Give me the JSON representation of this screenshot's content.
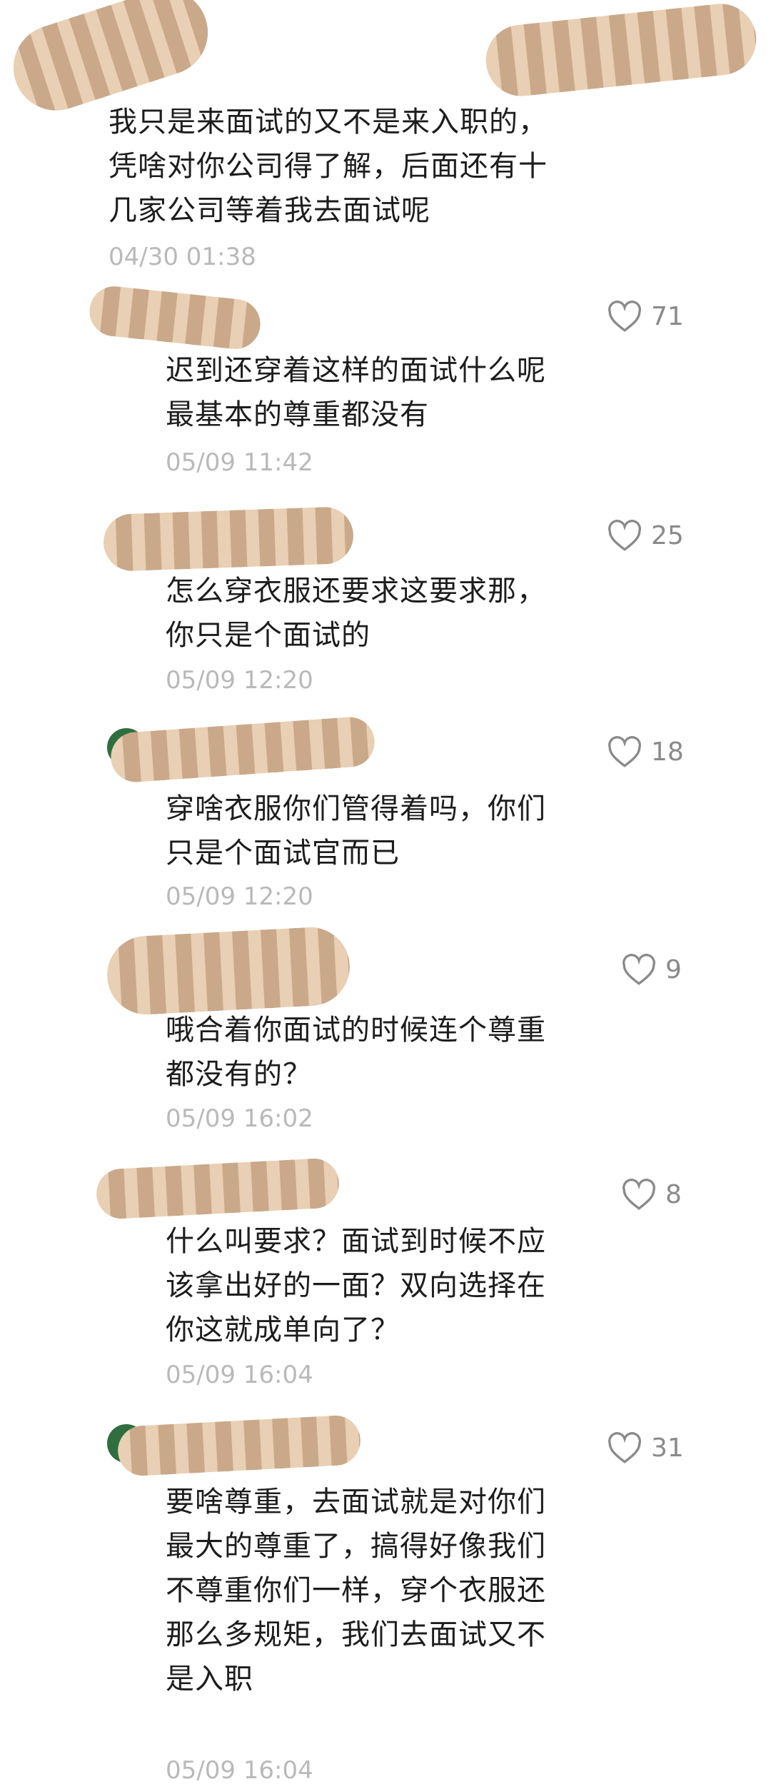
{
  "top_comment": {
    "text": "我只是来面试的又不是来入职的，\n凭啥对你公司得了解，后面还有十\n几家公司等着我去面试呢",
    "time": "04/30 01:38"
  },
  "replies": [
    {
      "text": "迟到还穿着这样的面试什么呢\n最基本的尊重都没有",
      "time": "05/09 11:42",
      "likes": "71"
    },
    {
      "text": "怎么穿衣服还要求这要求那，\n你只是个面试的",
      "time": "05/09 12:20",
      "likes": "25"
    },
    {
      "text": "穿啥衣服你们管得着吗，你们\n只是个面试官而已",
      "time": "05/09 12:20",
      "likes": "18"
    },
    {
      "text": "哦合着你面试的时候连个尊重\n都没有的？",
      "time": "05/09 16:02",
      "likes": "9"
    },
    {
      "text": "什么叫要求？面试到时候不应\n该拿出好的一面？双向选择在\n你这就成单向了？",
      "time": "05/09 16:04",
      "likes": "8"
    },
    {
      "text": "要啥尊重，去面试就是对你们\n最大的尊重了，搞得好像我们\n不尊重你们一样，穿个衣服还\n那么多规矩，我们去面试又不\n是入职",
      "time": "05/09 16:04",
      "likes": "31"
    }
  ],
  "icons": {
    "like": "heart-outline-icon"
  },
  "colors": {
    "text": "#1d1d1d",
    "time": "#b9b9b9",
    "count": "#8a8a8a",
    "redaction": "#e9cfb3"
  }
}
